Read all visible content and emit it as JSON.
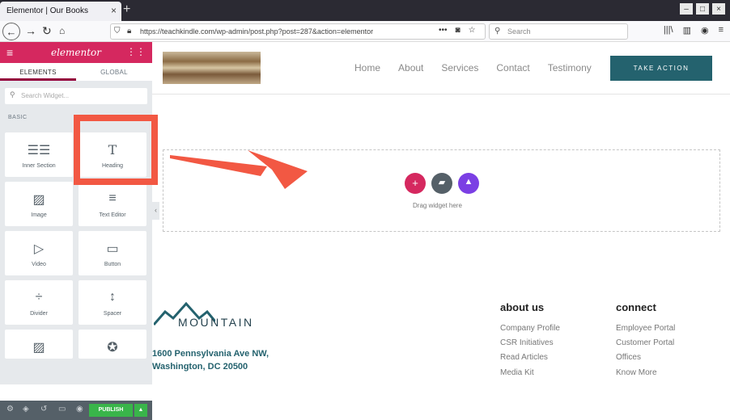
{
  "browser": {
    "tab_title": "Elementor | Our Books",
    "tab_close": "×",
    "new_tab": "+",
    "url": "https://teachkindle.com/wp-admin/post.php?post=287&action=elementor",
    "search_placeholder": "Search"
  },
  "panel": {
    "logo": "elementor",
    "tabs": [
      {
        "label": "ELEMENTS"
      },
      {
        "label": "GLOBAL"
      }
    ],
    "search_placeholder": "Search Widget...",
    "section_label": "BASIC",
    "widgets": [
      {
        "label": "Inner Section",
        "icon": "columns-icon"
      },
      {
        "label": "Heading",
        "icon": "heading-icon"
      },
      {
        "label": "Image",
        "icon": "image-icon"
      },
      {
        "label": "Text Editor",
        "icon": "text-editor-icon"
      },
      {
        "label": "Video",
        "icon": "video-icon"
      },
      {
        "label": "Button",
        "icon": "button-icon"
      },
      {
        "label": "Divider",
        "icon": "divider-icon"
      },
      {
        "label": "Spacer",
        "icon": "spacer-icon"
      },
      {
        "label": "",
        "icon": "image-box-icon"
      },
      {
        "label": "",
        "icon": "star-icon"
      }
    ],
    "publish_label": "PUBLISH"
  },
  "site": {
    "nav": [
      "Home",
      "About",
      "Services",
      "Contact",
      "Testimony"
    ],
    "cta_label": "TAKE ACTION",
    "drop_text": "Drag widget here",
    "footer": {
      "brand": "MOUNTAIN",
      "address_line1": "1600 Pennsylvania Ave NW,",
      "address_line2": "Washington, DC 20500",
      "about_title": "about us",
      "about_links": [
        "Company Profile",
        "CSR Initiatives",
        "Read Articles",
        "Media Kit"
      ],
      "connect_title": "connect",
      "connect_links": [
        "Employee Portal",
        "Customer Portal",
        "Offices",
        "Know More"
      ]
    }
  },
  "colors": {
    "elementor_pink": "#d5285f",
    "highlight_red": "#f25843",
    "teal": "#24626e",
    "publish_green": "#39b54a"
  }
}
